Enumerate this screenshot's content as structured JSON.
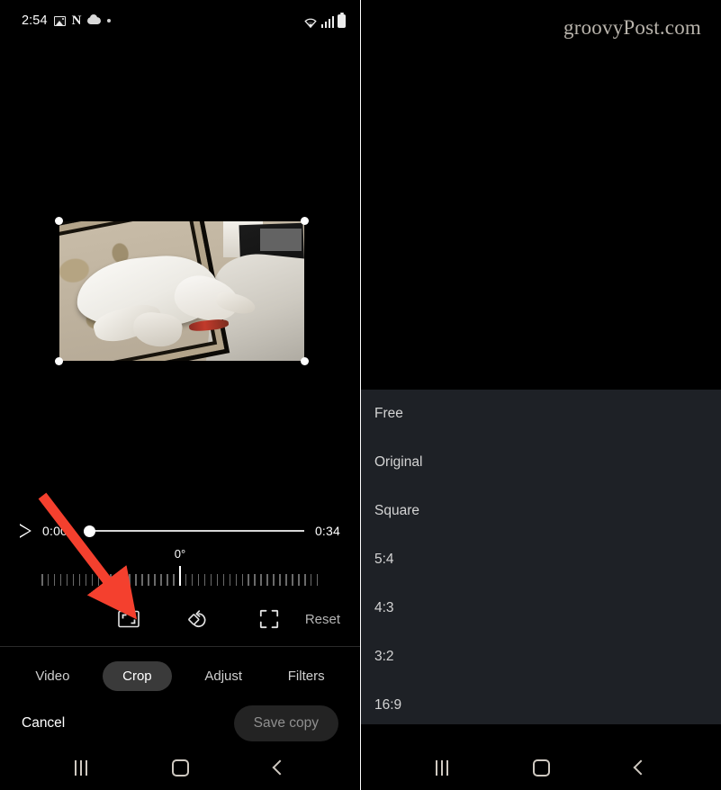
{
  "watermark": "groovyPost.com",
  "status_bar": {
    "clock": "2:54",
    "icons": [
      "photo-icon",
      "netflix-n-icon",
      "cloud-icon",
      "dot-icon"
    ],
    "right_icons": [
      "wifi-icon",
      "signal-icon",
      "battery-icon"
    ]
  },
  "editor": {
    "player": {
      "play_icon": "play-icon",
      "current_time": "0:00",
      "total_time": "0:34",
      "progress_percent": 0
    },
    "rotation": {
      "value_label": "0°",
      "degrees": 0,
      "tick_count": 45
    },
    "tools": [
      {
        "name": "aspect-ratio-icon",
        "label": "Aspect ratio"
      },
      {
        "name": "rotate-icon",
        "label": "Rotate"
      },
      {
        "name": "free-crop-icon",
        "label": "Free crop"
      }
    ],
    "reset_label": "Reset",
    "tabs": [
      {
        "label": "Video",
        "active": false
      },
      {
        "label": "Crop",
        "active": true
      },
      {
        "label": "Adjust",
        "active": false
      },
      {
        "label": "Filters",
        "active": false
      }
    ],
    "cancel_label": "Cancel",
    "save_label": "Save copy"
  },
  "aspect_sheet": {
    "items": [
      {
        "label": "Free"
      },
      {
        "label": "Original"
      },
      {
        "label": "Square"
      },
      {
        "label": "5:4"
      },
      {
        "label": "4:3"
      },
      {
        "label": "3:2"
      },
      {
        "label": "16:9"
      }
    ]
  },
  "navbar": {
    "recents_label": "Recents",
    "home_label": "Home",
    "back_label": "Back"
  },
  "annotation": {
    "arrow_color": "#f4402e",
    "points_to": "aspect-ratio-icon"
  },
  "colors": {
    "background": "#000000",
    "sheet_background": "#1e2126",
    "active_tab": "#3a3a3a",
    "accent_arrow": "#f4402e",
    "text_primary": "#ffffff",
    "text_secondary": "#b4b4b4"
  }
}
